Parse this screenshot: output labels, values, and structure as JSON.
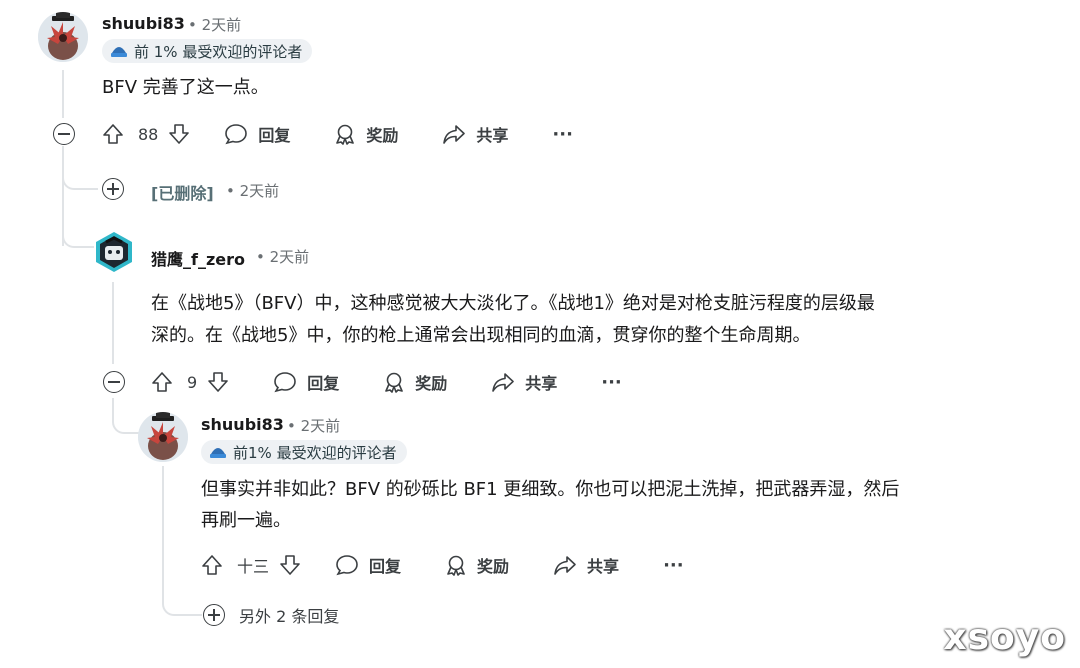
{
  "comments": [
    {
      "username": "shuubi83",
      "time": "• 2天前",
      "flair": "前 1% 最受欢迎的评论者",
      "body": "BFV 完善了这一点。",
      "votes": "88",
      "reply": "回复",
      "award": "奖励",
      "share": "共享",
      "more": "···"
    },
    {
      "username": "[已删除]",
      "time": "• 2天前"
    },
    {
      "username": "猎鹰_f_zero",
      "time": "• 2天前",
      "body_line1": "在《战地5》（BFV）中，这种感觉被大大淡化了。《战地1》绝对是对枪支脏污程度的层级最",
      "body_line2": "深的。在《战地5》中，你的枪上通常会出现相同的血滴，贯穿你的整个生命周期。",
      "votes": "9",
      "reply": "回复",
      "award": "奖励",
      "share": "共享",
      "more": "···"
    },
    {
      "username": "shuubi83",
      "time": "• 2天前",
      "flair": "前1% 最受欢迎的评论者",
      "body_line1": "但事实并非如此？BFV 的砂砾比 BF1 更细致。你也可以把泥土洗掉，把武器弄湿，然后",
      "body_line2": "再刷一遍。",
      "votes": "十三",
      "reply": "回复",
      "award": "奖励",
      "share": "共享",
      "more": "···"
    }
  ],
  "more_replies": "另外 2 条回复",
  "watermark": "xsoyo"
}
